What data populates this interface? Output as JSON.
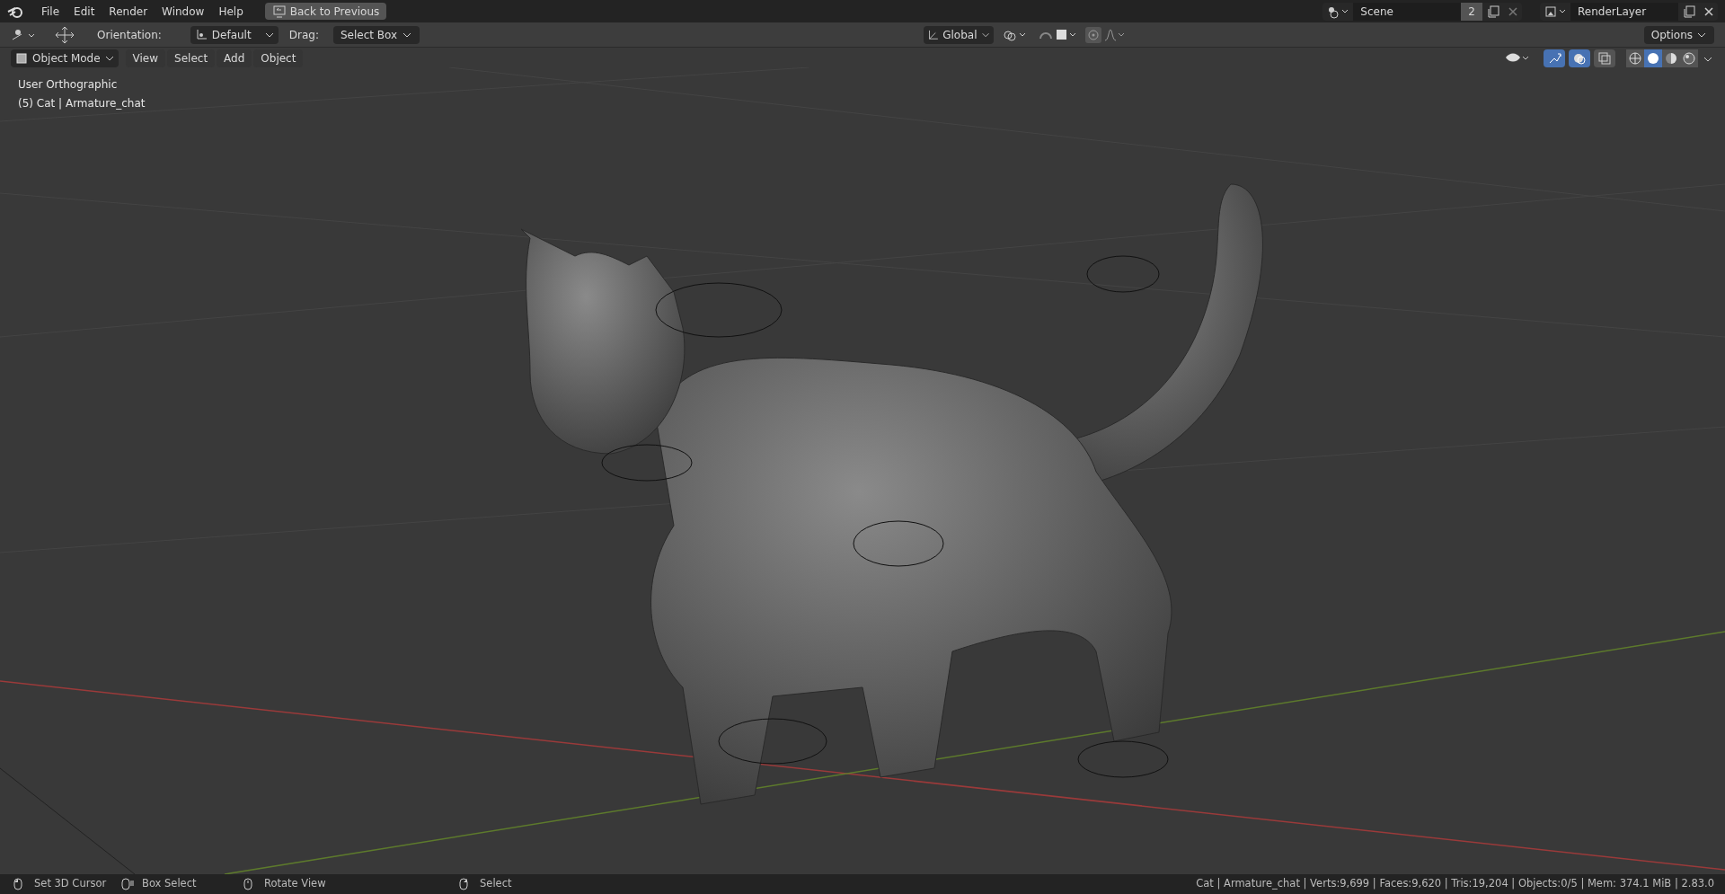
{
  "top_menu": [
    "File",
    "Edit",
    "Render",
    "Window",
    "Help"
  ],
  "back_button": "Back to Previous",
  "scene": {
    "name": "Scene",
    "users": "2"
  },
  "view_layer": {
    "name": "RenderLayer"
  },
  "tool_header": {
    "orientation_label": "Orientation:",
    "orientation": "Default",
    "drag_label": "Drag:",
    "drag": "Select Box",
    "transform_orientation": "Global",
    "options": "Options"
  },
  "viewport_header": {
    "mode": "Object Mode",
    "menus": [
      "View",
      "Select",
      "Add",
      "Object"
    ],
    "toggles": [
      {
        "kind": "gizmo",
        "on": true
      },
      {
        "kind": "overlay",
        "on": true
      },
      {
        "kind": "xray",
        "on": false
      }
    ],
    "shading": [
      {
        "kind": "wireframe",
        "selected": false
      },
      {
        "kind": "solid",
        "selected": true
      },
      {
        "kind": "material",
        "selected": false
      },
      {
        "kind": "rendered",
        "selected": false
      }
    ]
  },
  "viewport_info": [
    "User Orthographic",
    "(5) Cat | Armature_chat"
  ],
  "status_bar": {
    "hints": [
      {
        "kind": "left",
        "label": "Set 3D Cursor"
      },
      {
        "kind": "drag",
        "label": "Box Select"
      },
      {
        "kind": "middle",
        "label": "Rotate View"
      },
      {
        "kind": "right",
        "label": "Select"
      }
    ],
    "stats": "Cat | Armature_chat | Verts:9,699 | Faces:9,620 | Tris:19,204 | Objects:0/5 | Mem: 374.1 MiB | 2.83.0"
  }
}
